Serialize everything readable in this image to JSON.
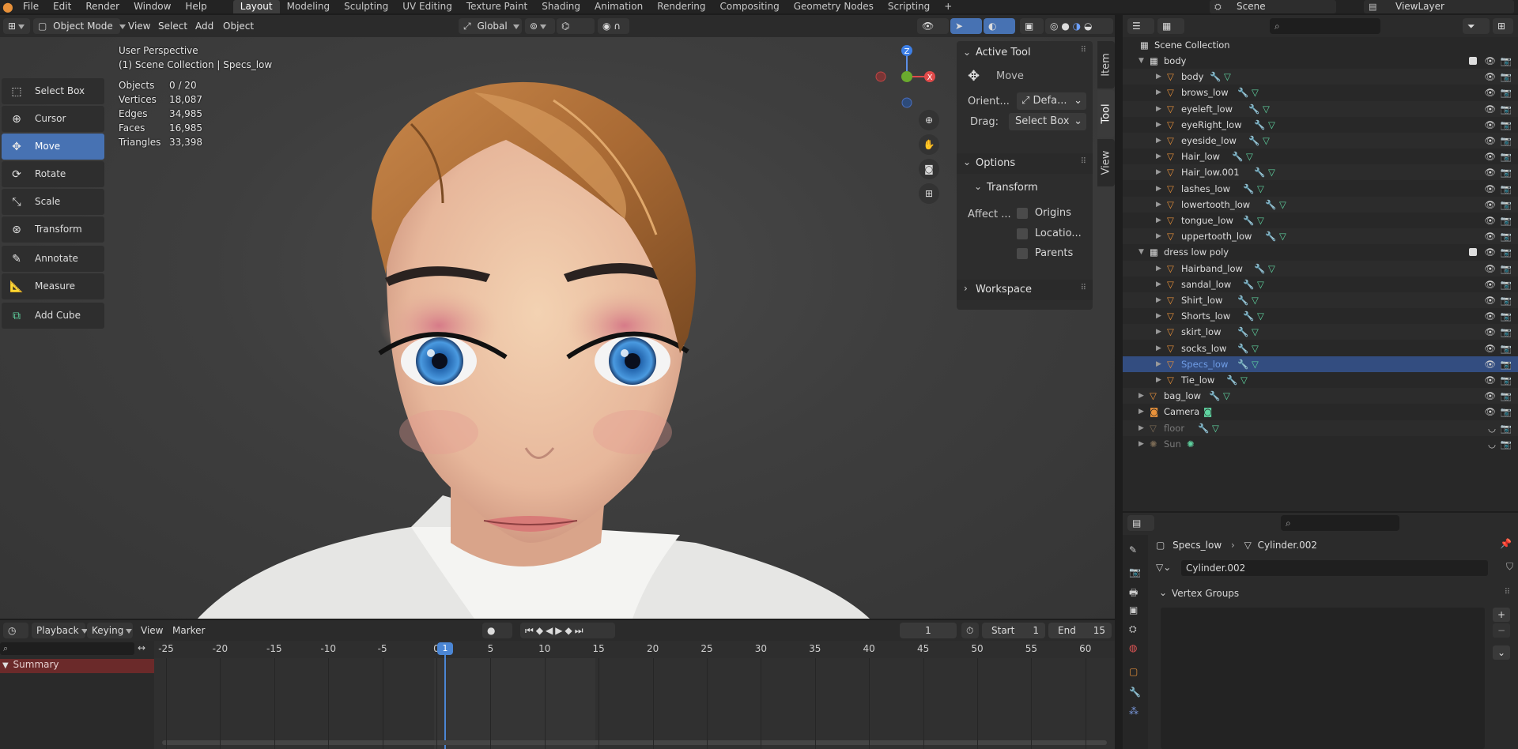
{
  "topbar": {
    "menus": [
      "File",
      "Edit",
      "Render",
      "Window",
      "Help"
    ],
    "workspaces": [
      "Layout",
      "Modeling",
      "Sculpting",
      "UV Editing",
      "Texture Paint",
      "Shading",
      "Animation",
      "Rendering",
      "Compositing",
      "Geometry Nodes",
      "Scripting"
    ],
    "active_workspace": "Layout",
    "add_tab": "+",
    "scene": "Scene",
    "view_layer": "ViewLayer"
  },
  "viewport_header": {
    "mode": "Object Mode",
    "menus": [
      "View",
      "Select",
      "Add",
      "Object"
    ],
    "orientation": "Global"
  },
  "overlay_text": {
    "perspective": "User Perspective",
    "collection": "(1) Scene Collection | Specs_low"
  },
  "stats": [
    {
      "label": "Objects",
      "value": "0 / 20"
    },
    {
      "label": "Vertices",
      "value": "18,087"
    },
    {
      "label": "Edges",
      "value": "34,985"
    },
    {
      "label": "Faces",
      "value": "16,985"
    },
    {
      "label": "Triangles",
      "value": "33,398"
    }
  ],
  "tools": [
    {
      "label": "Select Box",
      "icon": "select-box-icon",
      "active": false
    },
    {
      "label": "Cursor",
      "icon": "cursor-icon",
      "active": false
    },
    {
      "label": "Move",
      "icon": "move-icon",
      "active": true
    },
    {
      "label": "Rotate",
      "icon": "rotate-icon",
      "active": false
    },
    {
      "label": "Scale",
      "icon": "scale-icon",
      "active": false
    },
    {
      "label": "Transform",
      "icon": "transform-icon",
      "active": false
    },
    {
      "label": "Annotate",
      "icon": "annotate-icon",
      "active": false
    },
    {
      "label": "Measure",
      "icon": "measure-icon",
      "active": false
    },
    {
      "label": "Add Cube",
      "icon": "add-cube-icon",
      "active": false
    }
  ],
  "gizmo": {
    "z": "Z",
    "x": "X"
  },
  "npanel": {
    "active_tool_title": "Active Tool",
    "tool_name": "Move",
    "orient_label": "Orient...",
    "orient_value": "Defa...",
    "drag_label": "Drag:",
    "drag_value": "Select Box",
    "options_title": "Options",
    "transform_title": "Transform",
    "affect_label": "Affect ...",
    "checkboxes": [
      "Origins",
      "Locatio...",
      "Parents"
    ],
    "workspace_title": "Workspace",
    "tabs": [
      "Item",
      "Tool",
      "View"
    ]
  },
  "outliner": {
    "root": "Scene Collection",
    "rows": [
      {
        "name": "body",
        "kind": "collection",
        "indent": 1
      },
      {
        "name": "body",
        "kind": "mesh",
        "indent": 2
      },
      {
        "name": "brows_low",
        "kind": "mesh",
        "indent": 2
      },
      {
        "name": "eyeleft_low",
        "kind": "mesh",
        "indent": 2
      },
      {
        "name": "eyeRight_low",
        "kind": "mesh",
        "indent": 2
      },
      {
        "name": "eyeside_low",
        "kind": "mesh",
        "indent": 2
      },
      {
        "name": "Hair_low",
        "kind": "mesh",
        "indent": 2
      },
      {
        "name": "Hair_low.001",
        "kind": "mesh",
        "indent": 2
      },
      {
        "name": "lashes_low",
        "kind": "mesh",
        "indent": 2
      },
      {
        "name": "lowertooth_low",
        "kind": "mesh",
        "indent": 2
      },
      {
        "name": "tongue_low",
        "kind": "mesh",
        "indent": 2
      },
      {
        "name": "uppertooth_low",
        "kind": "mesh",
        "indent": 2
      },
      {
        "name": "dress low poly",
        "kind": "collection",
        "indent": 1
      },
      {
        "name": "Hairband_low",
        "kind": "mesh",
        "indent": 2
      },
      {
        "name": "sandal_low",
        "kind": "mesh",
        "indent": 2
      },
      {
        "name": "Shirt_low",
        "kind": "mesh",
        "indent": 2
      },
      {
        "name": "Shorts_low",
        "kind": "mesh",
        "indent": 2
      },
      {
        "name": "skirt_low",
        "kind": "mesh",
        "indent": 2
      },
      {
        "name": "socks_low",
        "kind": "mesh",
        "indent": 2
      },
      {
        "name": "Specs_low",
        "kind": "mesh",
        "indent": 2,
        "selected": true
      },
      {
        "name": "Tie_low",
        "kind": "mesh",
        "indent": 2
      },
      {
        "name": "bag_low",
        "kind": "mesh",
        "indent": 1
      },
      {
        "name": "Camera",
        "kind": "camera",
        "indent": 1
      },
      {
        "name": "floor",
        "kind": "mesh",
        "indent": 1,
        "dim": true
      },
      {
        "name": "Sun",
        "kind": "light",
        "indent": 1,
        "dim": true
      }
    ]
  },
  "properties": {
    "breadcrumb_object": "Specs_low",
    "breadcrumb_data": "Cylinder.002",
    "data_name": "Cylinder.002",
    "section": "Vertex Groups"
  },
  "timeline": {
    "menus": [
      "Playback",
      "Keying",
      "View",
      "Marker"
    ],
    "current_frame": "1",
    "start_label": "Start",
    "start": "1",
    "end_label": "End",
    "end": "15",
    "ticks": [
      "-25",
      "-20",
      "-15",
      "-10",
      "-5",
      "0",
      "5",
      "10",
      "15",
      "20",
      "25",
      "30",
      "35",
      "40",
      "45",
      "50",
      "55",
      "60"
    ],
    "playhead": "1",
    "summary": "Summary"
  }
}
